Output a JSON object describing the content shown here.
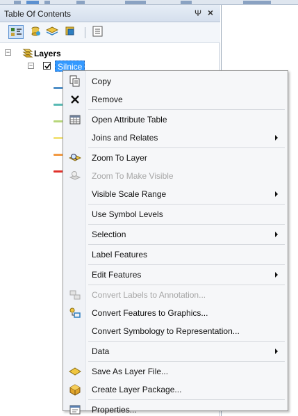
{
  "window": {
    "title": "Table Of Contents",
    "pin_glyph": "Ψ",
    "close_glyph": "×"
  },
  "toolbar": {
    "buttons": [
      "list-by-drawing-order-icon",
      "list-by-source-icon",
      "list-by-visibility-icon",
      "list-by-selection-icon",
      "options-icon"
    ]
  },
  "tree": {
    "root": {
      "label": "Layers",
      "expander": "−"
    },
    "layer": {
      "label": "Silnice",
      "expander": "−",
      "checked": true
    },
    "legend_colors": [
      "#4f8fc7",
      "#57b9b3",
      "#b7d67a",
      "#f2e27a",
      "#f29a43",
      "#e0312b"
    ]
  },
  "context_menu": {
    "items": [
      {
        "label": "Copy",
        "icon": "copy-icon",
        "enabled": true,
        "submenu": false
      },
      {
        "label": "Remove",
        "icon": "remove-icon",
        "enabled": true,
        "submenu": false
      },
      {
        "label": "Open Attribute Table",
        "icon": "table-icon",
        "enabled": true,
        "submenu": false
      },
      {
        "label": "Joins and Relates",
        "icon": "",
        "enabled": true,
        "submenu": true
      },
      {
        "label": "Zoom To Layer",
        "icon": "zoom-to-layer-icon",
        "enabled": true,
        "submenu": false
      },
      {
        "label": "Zoom To Make Visible",
        "icon": "zoom-to-make-visible-icon",
        "enabled": false,
        "submenu": false
      },
      {
        "label": "Visible Scale Range",
        "icon": "",
        "enabled": true,
        "submenu": true
      },
      {
        "label": "Use Symbol Levels",
        "icon": "",
        "enabled": true,
        "submenu": false
      },
      {
        "label": "Selection",
        "icon": "",
        "enabled": true,
        "submenu": true
      },
      {
        "label": "Label Features",
        "icon": "",
        "enabled": true,
        "submenu": false
      },
      {
        "label": "Edit Features",
        "icon": "",
        "enabled": true,
        "submenu": true
      },
      {
        "label": "Convert Labels to Annotation...",
        "icon": "convert-labels-icon",
        "enabled": false,
        "submenu": false
      },
      {
        "label": "Convert Features to Graphics...",
        "icon": "convert-graphics-icon",
        "enabled": true,
        "submenu": false
      },
      {
        "label": "Convert Symbology to Representation...",
        "icon": "",
        "enabled": true,
        "submenu": false
      },
      {
        "label": "Data",
        "icon": "",
        "enabled": true,
        "submenu": true
      },
      {
        "label": "Save As Layer File...",
        "icon": "layer-file-icon",
        "enabled": true,
        "submenu": false
      },
      {
        "label": "Create Layer Package...",
        "icon": "layer-package-icon",
        "enabled": true,
        "submenu": false
      },
      {
        "label": "Properties...",
        "icon": "properties-icon",
        "enabled": true,
        "submenu": false
      }
    ]
  }
}
